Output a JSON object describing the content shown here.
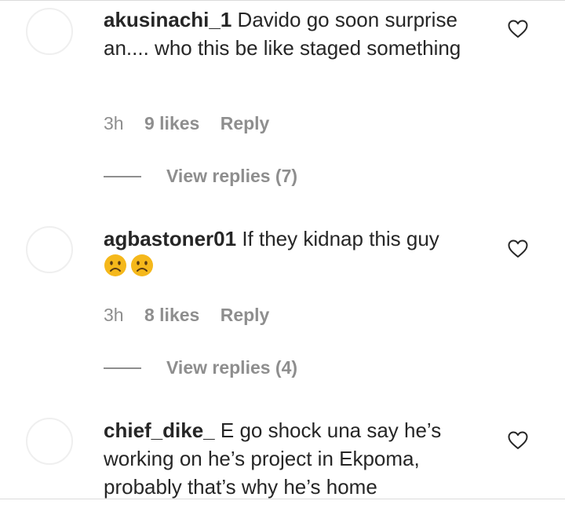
{
  "comments": [
    {
      "username": "akusinachi_1",
      "text": "Davido go soon surprise an.... who this be like staged something",
      "time": "3h",
      "likes": "9 likes",
      "reply_label": "Reply",
      "view_replies": "View replies (7)"
    },
    {
      "username": "agbastoner01",
      "text": "If they kidnap this guy",
      "emojis": [
        "sad-face-emoji",
        "sad-face-emoji"
      ],
      "time": "3h",
      "likes": "8 likes",
      "reply_label": "Reply",
      "view_replies": "View replies (4)"
    },
    {
      "username": "chief_dike_",
      "text": "E go shock una say he’s working on he’s project in Ekpoma, probably that’s why he’s home"
    }
  ],
  "icons": {
    "like": "heart-outline-icon"
  },
  "colors": {
    "text": "#262626",
    "secondary": "#8e8e8e",
    "divider": "#dbdbdb",
    "emoji": "#f5b81b"
  }
}
